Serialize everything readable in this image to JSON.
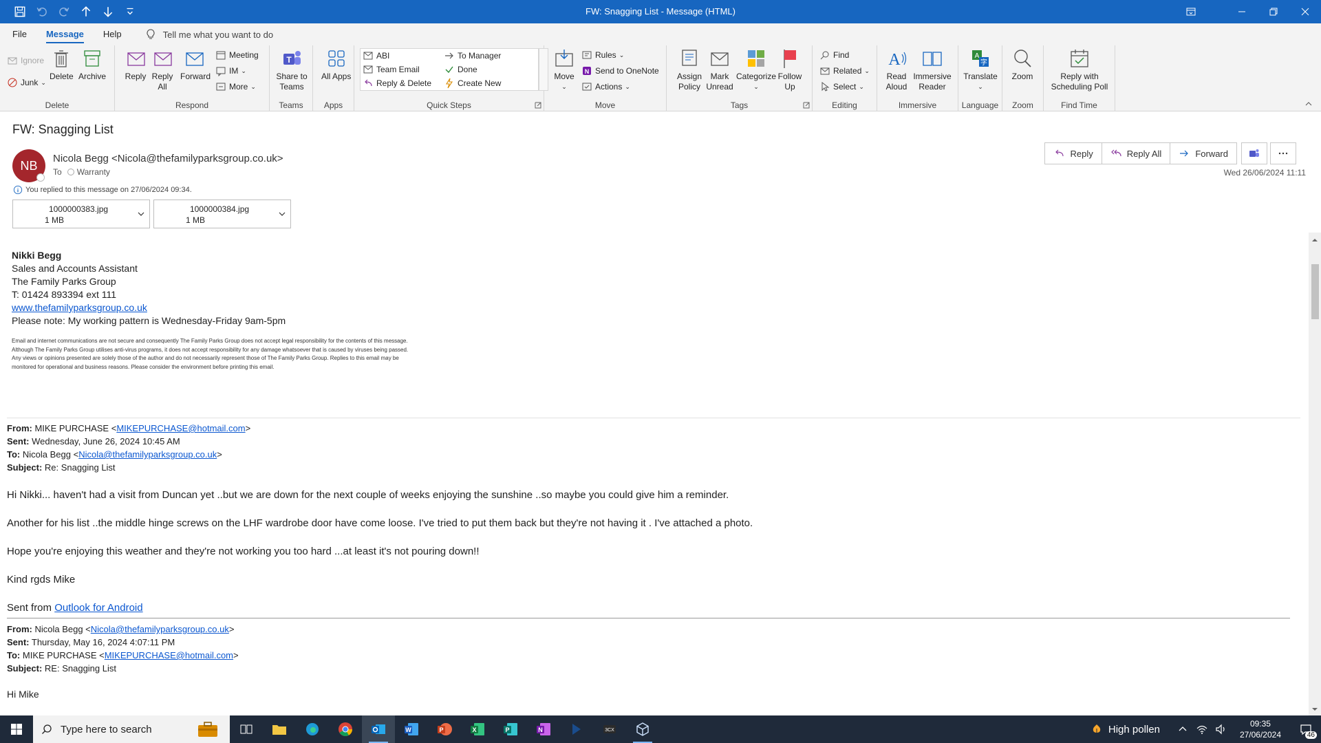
{
  "window": {
    "title": "FW: Snagging List  -  Message (HTML)"
  },
  "menu": {
    "tabs": [
      "File",
      "Message",
      "Help"
    ],
    "tellme": "Tell me what you want to do"
  },
  "ribbon": {
    "delete_group": {
      "label": "Delete",
      "ignore": "Ignore",
      "junk": "Junk",
      "delete": "Delete",
      "archive": "Archive"
    },
    "respond_group": {
      "label": "Respond",
      "reply": "Reply",
      "reply_all": "Reply All",
      "forward": "Forward",
      "meeting": "Meeting",
      "im": "IM",
      "more": "More"
    },
    "teams_group": {
      "label": "Teams",
      "share": "Share to Teams"
    },
    "apps_group": {
      "label": "Apps",
      "all_apps": "All Apps"
    },
    "quicksteps_group": {
      "label": "Quick Steps",
      "items": [
        "ABI",
        "Team Email",
        "Reply & Delete",
        "To Manager",
        "Done",
        "Create New"
      ]
    },
    "move_group": {
      "label": "Move",
      "move": "Move",
      "rules": "Rules",
      "onenote": "Send to OneNote",
      "actions": "Actions"
    },
    "tags_group": {
      "label": "Tags",
      "assign_policy": "Assign Policy",
      "mark_unread": "Mark Unread",
      "categorize": "Categorize",
      "follow_up": "Follow Up"
    },
    "editing_group": {
      "label": "Editing",
      "find": "Find",
      "related": "Related",
      "select": "Select"
    },
    "immersive_group": {
      "label": "Immersive",
      "read_aloud": "Read Aloud",
      "immersive_reader": "Immersive Reader"
    },
    "language_group": {
      "label": "Language",
      "translate": "Translate"
    },
    "zoom_group": {
      "label": "Zoom",
      "zoom": "Zoom"
    },
    "findtime_group": {
      "label": "Find Time",
      "reply_poll": "Reply with Scheduling Poll"
    }
  },
  "message": {
    "subject": "FW: Snagging List",
    "avatar_initials": "NB",
    "avatar_color": "#a4262c",
    "sender": "Nicola Begg <Nicola@thefamilyparksgroup.co.uk>",
    "to_label": "To",
    "to": "Warranty",
    "replied_note": "You replied to this message on 27/06/2024 09:34.",
    "date": "Wed 26/06/2024 11:11",
    "actions": {
      "reply": "Reply",
      "reply_all": "Reply All",
      "forward": "Forward"
    },
    "attachments": [
      {
        "name": "1000000383.jpg",
        "size": "1 MB"
      },
      {
        "name": "1000000384.jpg",
        "size": "1 MB"
      }
    ]
  },
  "body": {
    "signature": {
      "name": "Nikki Begg",
      "role": "Sales and Accounts Assistant",
      "company": "The Family Parks Group",
      "phone": "T: 01424 893394 ext 111",
      "website": "www.thefamilyparksgroup.co.uk",
      "note": "Please note: My working pattern is Wednesday-Friday 9am-5pm",
      "disclaimer": "Email and internet communications are not secure and consequently The Family Parks Group does not accept legal responsibility for the contents of this message. Although The Family Parks Group utilises anti-virus programs, it does not accept responsibility for any damage whatsoever that is caused by viruses being passed. Any views or opinions presented are solely those of the author and do not necessarily represent those of The Family Parks Group. Replies to this email may be monitored for operational and business reasons. Please consider the environment before printing this email."
    },
    "fwd1": {
      "from_label": "From:",
      "from_name": "MIKE PURCHASE <",
      "from_email": "MIKEPURCHASE@hotmail.com",
      "from_end": ">",
      "sent_label": "Sent:",
      "sent": "Wednesday, June 26, 2024 10:45 AM",
      "to_label": "To:",
      "to_name": "Nicola Begg <",
      "to_email": "Nicola@thefamilyparksgroup.co.uk",
      "to_end": ">",
      "subject_label": "Subject:",
      "subject": "Re: Snagging List"
    },
    "paragraphs": [
      "Hi Nikki... haven't had a visit from Duncan yet ..but we are down for the next couple of weeks enjoying the sunshine ..so maybe you could give him a reminder.",
      "Another for his list ..the middle hinge screws on the LHF wardrobe door have come loose. I've tried to put them back but they're not having it . I've attached a photo.",
      "Hope you're enjoying this weather and they're not working you too hard ...at least it's not pouring down!!",
      "Kind rgds Mike"
    ],
    "sent_from": "Sent from ",
    "sent_from_link": "Outlook for Android",
    "fwd2": {
      "from_label": "From:",
      "from_name": "Nicola Begg <",
      "from_email": "Nicola@thefamilyparksgroup.co.uk",
      "from_end": ">",
      "sent_label": "Sent:",
      "sent": "Thursday, May 16, 2024 4:07:11 PM",
      "to_label": "To:",
      "to_name": "MIKE PURCHASE <",
      "to_email": "MIKEPURCHASE@hotmail.com",
      "to_end": ">",
      "subject_label": "Subject:",
      "subject": "RE: Snagging List"
    },
    "greeting": "Hi Mike"
  },
  "taskbar": {
    "search_placeholder": "Type here to search",
    "weather": "High pollen",
    "time": "09:35",
    "date": "27/06/2024",
    "notifications": "46"
  }
}
